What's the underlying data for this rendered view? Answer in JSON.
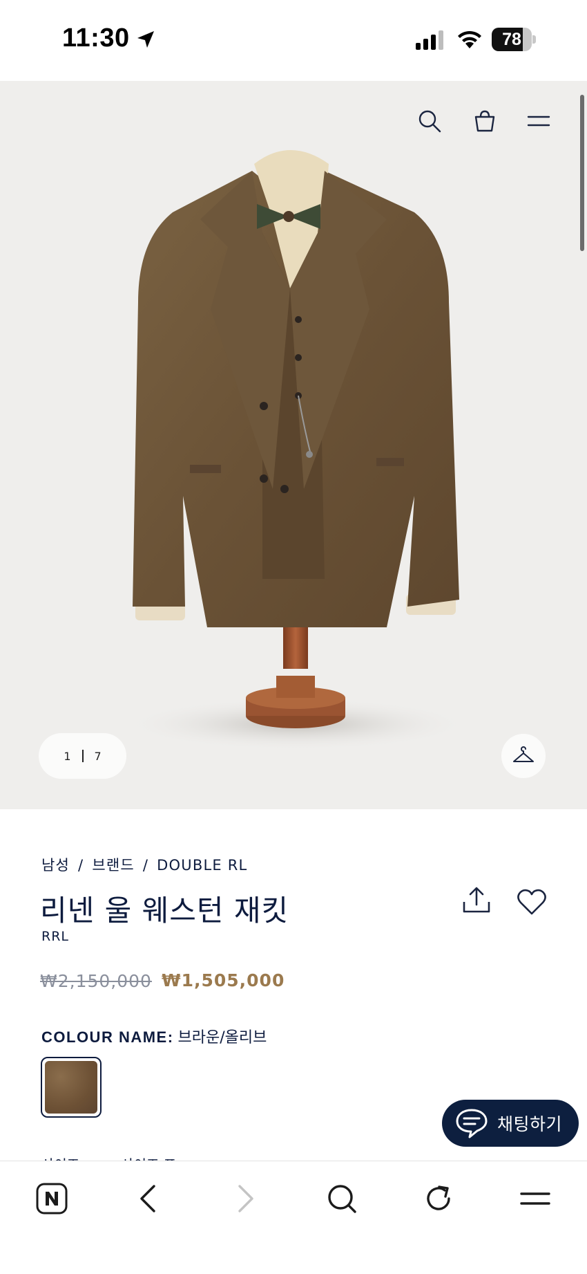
{
  "status_bar": {
    "time": "11:30",
    "battery_level": "78",
    "battery_fraction": 0.78,
    "icons": [
      "location-arrow-icon",
      "cellular-signal-icon",
      "wifi-icon",
      "battery-icon"
    ]
  },
  "hero": {
    "image_alt": "리넨 울 웨스턴 재킷",
    "page_current": "1",
    "page_total": "7",
    "icons": [
      "search-icon",
      "shopping-bag-icon",
      "menu-icon",
      "hanger-icon"
    ]
  },
  "product": {
    "breadcrumb": [
      "남성",
      "브랜드",
      "DOUBLE RL"
    ],
    "breadcrumb_sep": "/",
    "title": "리넨 울 웨스턴 재킷",
    "brand": "RRL",
    "price_original": "₩2,150,000",
    "price_sale": "₩1,505,000",
    "colour_label": "COLOUR NAME:",
    "colour_value": "브라운/올리브",
    "size_labels": [
      "사이즈",
      "사이즈 표"
    ]
  },
  "chat": {
    "label": "채팅하기"
  },
  "toolbar": {
    "items": [
      "naver-home-icon",
      "back-icon",
      "forward-icon",
      "search-icon",
      "refresh-icon",
      "menu-icon"
    ]
  },
  "colors": {
    "navy": "#0d1b3e",
    "sale_gold": "#9b7a4e",
    "hero_bg": "#efeeec",
    "chat_bg": "#0d1f3f"
  }
}
